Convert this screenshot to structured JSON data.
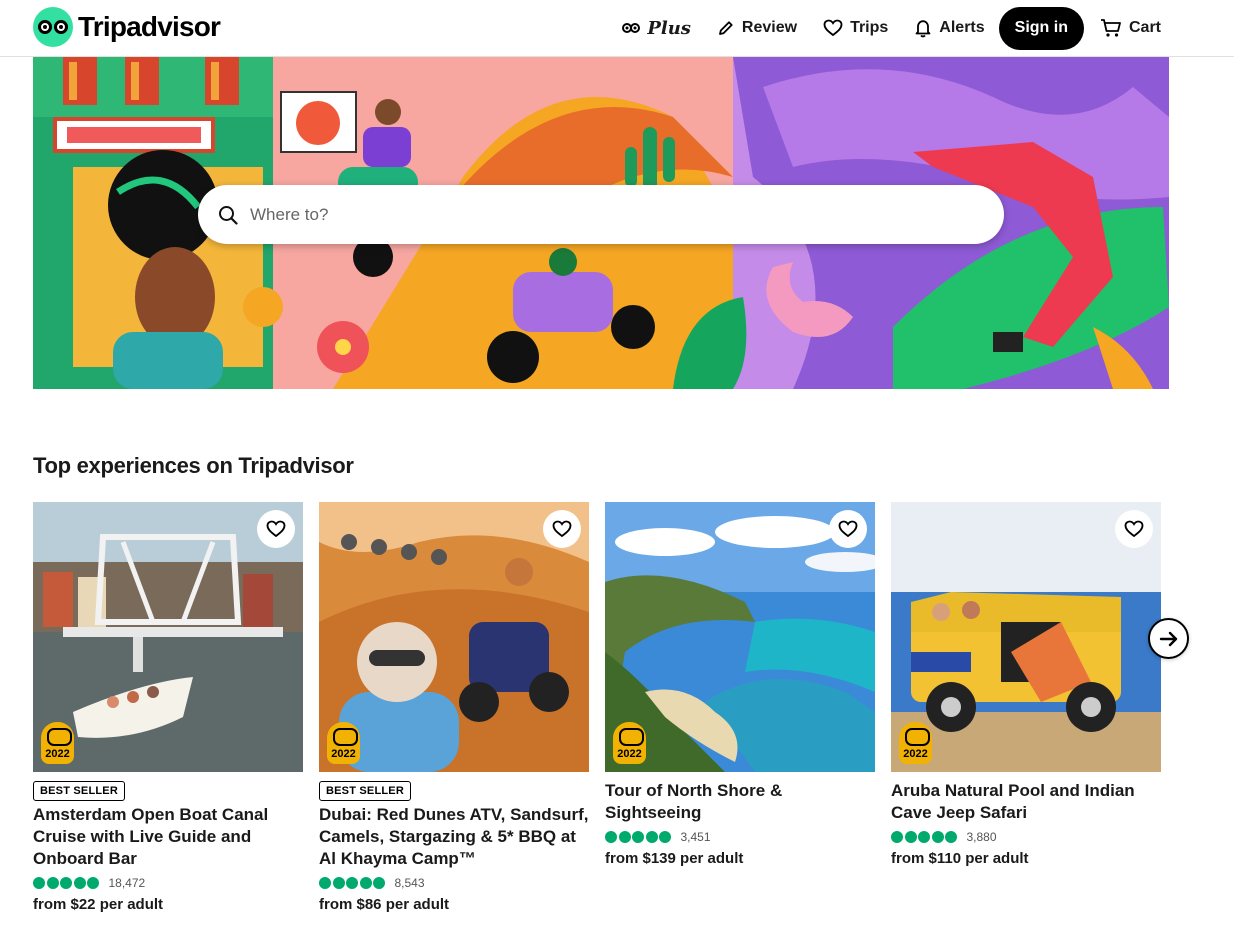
{
  "header": {
    "brand": "Tripadvisor",
    "nav": {
      "plus": "Plus",
      "review": "Review",
      "trips": "Trips",
      "alerts": "Alerts",
      "signin": "Sign in",
      "cart": "Cart"
    }
  },
  "hero": {
    "search_placeholder": "Where to?",
    "icons": {
      "search": "search-icon"
    }
  },
  "section": {
    "title": "Top experiences on Tripadvisor"
  },
  "cards": [
    {
      "badge": "BEST SELLER",
      "title": "Amsterdam Open Boat Canal Cruise with Live Guide and Onboard Bar",
      "rating_bubbles": 5,
      "reviews": "18,472",
      "price": "from $22 per adult",
      "award_year": "2022"
    },
    {
      "badge": "BEST SELLER",
      "title": "Dubai: Red Dunes ATV, Sandsurf, Camels, Stargazing & 5* BBQ at Al Khayma Camp™",
      "rating_bubbles": 5,
      "reviews": "8,543",
      "price": "from $86 per adult",
      "award_year": "2022"
    },
    {
      "badge": "",
      "title": "Tour of North Shore & Sightseeing",
      "rating_bubbles": 5,
      "reviews": "3,451",
      "price": "from $139 per adult",
      "award_year": "2022"
    },
    {
      "badge": "",
      "title": "Aruba Natural Pool and Indian Cave Jeep Safari",
      "rating_bubbles": 5,
      "reviews": "3,880",
      "price": "from $110 per adult",
      "award_year": "2022"
    }
  ],
  "colors": {
    "brand_green": "#34e0a1",
    "rating_green": "#00aa6c",
    "award_gold": "#f2b203",
    "text": "#1a1a1a"
  }
}
